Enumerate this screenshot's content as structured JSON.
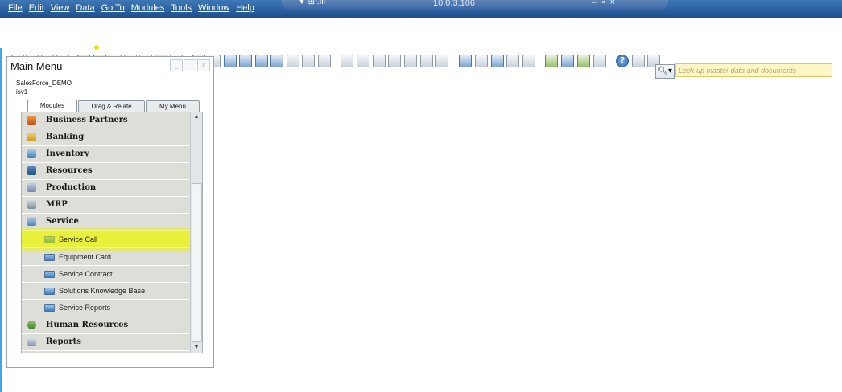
{
  "menubar": {
    "items": [
      "File",
      "Edit",
      "View",
      "Data",
      "Go To",
      "Modules",
      "Tools",
      "Window",
      "Help"
    ],
    "remote_address": "10.0.3.106"
  },
  "search": {
    "placeholder": "Look up master data and documents"
  },
  "main_menu": {
    "title": "Main Menu",
    "company": "SalesForce_DEMO",
    "user": "isv1",
    "tabs": [
      "Modules",
      "Drag & Relate",
      "My Menu"
    ],
    "active_tab": "Modules",
    "modules": [
      {
        "label": "Business Partners",
        "icon": "business-partners-icon"
      },
      {
        "label": "Banking",
        "icon": "banking-icon"
      },
      {
        "label": "Inventory",
        "icon": "inventory-icon"
      },
      {
        "label": "Resources",
        "icon": "resources-icon"
      },
      {
        "label": "Production",
        "icon": "production-icon"
      },
      {
        "label": "MRP",
        "icon": "mrp-icon"
      },
      {
        "label": "Service",
        "icon": "service-icon"
      }
    ],
    "service_items": [
      {
        "label": "Service Call",
        "highlighted": true
      },
      {
        "label": "Equipment Card"
      },
      {
        "label": "Service Contract"
      },
      {
        "label": "Solutions Knowledge Base"
      },
      {
        "label": "Service Reports",
        "folder": true
      }
    ],
    "more_modules": [
      {
        "label": "Human Resources",
        "icon": "human-resources-icon"
      },
      {
        "label": "Reports",
        "icon": "reports-icon"
      }
    ]
  },
  "colors": {
    "menubar": "#1f4f8e",
    "highlight": "#e8f01e",
    "panel": "#dcded7"
  }
}
